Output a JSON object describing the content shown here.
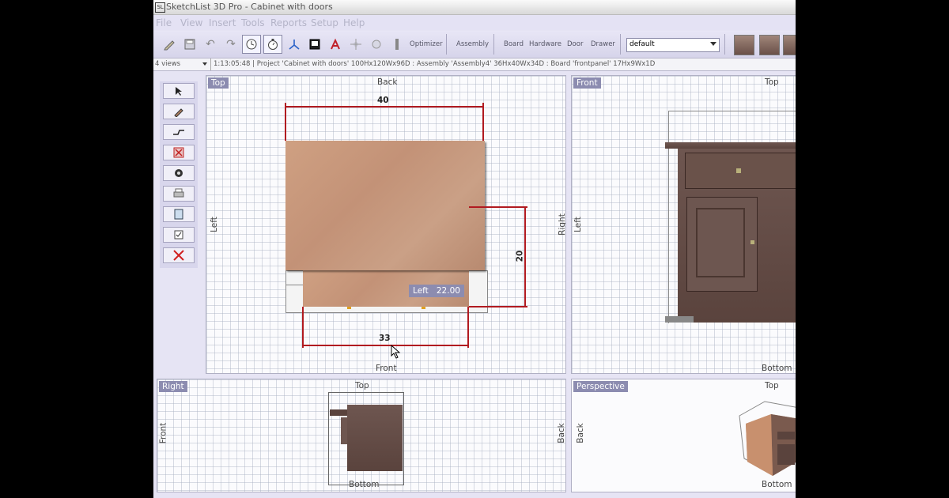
{
  "window": {
    "title": "SketchList 3D Pro - Cabinet with doors"
  },
  "menu": [
    "File",
    "View",
    "Insert",
    "Tools",
    "Reports",
    "Setup",
    "Help"
  ],
  "toolbar": {
    "optimizer": "Optimizer",
    "assembly": "Assembly",
    "board": "Board",
    "hardware": "Hardware",
    "door": "Door",
    "drawer": "Drawer",
    "material_value": "default"
  },
  "statusbar": {
    "views": "4 views",
    "text": "1:13:05:48 | Project 'Cabinet with doors' 100Hx120Wx96D : Assembly 'Assembly4' 36Hx40Wx34D : Board 'frontpanel' 17Hx9Wx1D"
  },
  "viewports": {
    "top": {
      "tag": "Top",
      "back": "Back",
      "front": "Front",
      "left": "Left",
      "right": "Right",
      "dim_width": "40",
      "dim_depth": "20",
      "dim_lower": "33",
      "readout_label": "Left",
      "readout_value": "22.00"
    },
    "front": {
      "tag": "Front",
      "top": "Top",
      "bottom": "Bottom",
      "left": "Left"
    },
    "right": {
      "tag": "Right",
      "top": "Top",
      "bottom": "Bottom",
      "front": "Front",
      "back": "Back"
    },
    "perspective": {
      "tag": "Perspective",
      "top": "Top",
      "bottom": "Bottom",
      "back": "Back"
    }
  },
  "colors": {
    "dimension": "#b11a20",
    "tag_bg": "#8c8cb0",
    "wood": "#c39277"
  }
}
